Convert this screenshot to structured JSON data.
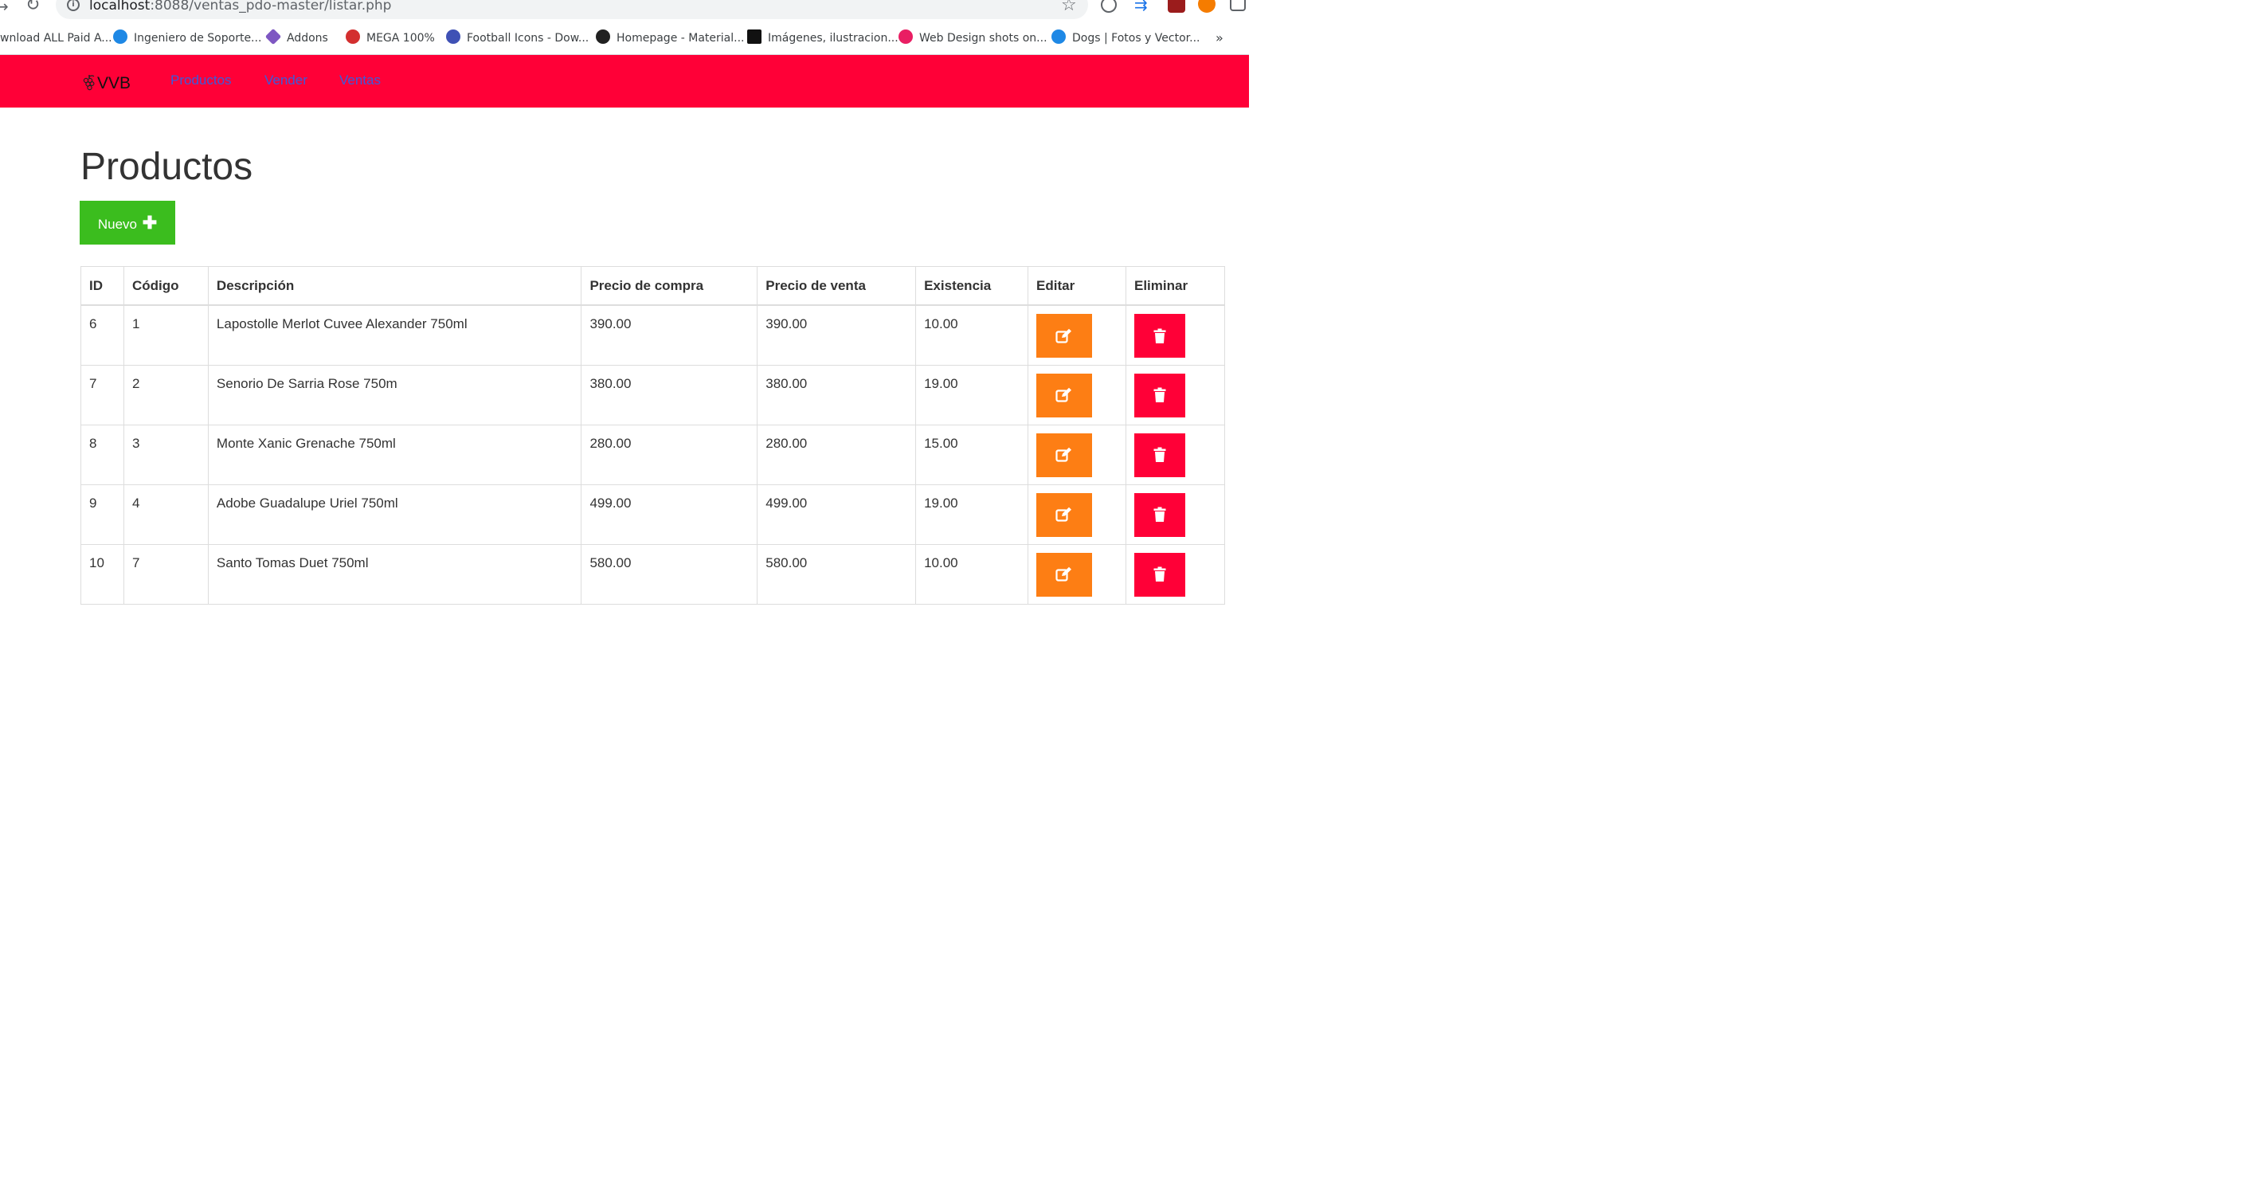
{
  "browser": {
    "url_host": "localhost",
    "url_rest": ":8088/ventas_pdo-master/listar.php",
    "bookmarks": [
      {
        "label": "wnload ALL Paid A...",
        "color": "#ffffff"
      },
      {
        "label": "Ingeniero de Soporte...",
        "color": "#1e88e5"
      },
      {
        "label": "Addons",
        "color": "#7e57c2"
      },
      {
        "label": "MEGA 100%",
        "color": "#d32f2f"
      },
      {
        "label": "Football Icons - Dow...",
        "color": "#3f51b5"
      },
      {
        "label": "Homepage - Material...",
        "color": "#212121"
      },
      {
        "label": "Imágenes, ilustracion...",
        "color": "#111111"
      },
      {
        "label": "Web Design shots on...",
        "color": "#e91e63"
      },
      {
        "label": "Dogs | Fotos y Vector...",
        "color": "#1e88e5"
      }
    ],
    "more": "»"
  },
  "navbar": {
    "brand": "VVB",
    "links": [
      "Productos",
      "Vender",
      "Ventas"
    ],
    "bg_color": "#ff0037"
  },
  "page": {
    "title": "Productos",
    "new_button": "Nuevo",
    "new_icon": "plus-icon"
  },
  "table": {
    "headers": [
      "ID",
      "Código",
      "Descripción",
      "Precio de compra",
      "Precio de venta",
      "Existencia",
      "Editar",
      "Eliminar"
    ],
    "rows": [
      {
        "id": "6",
        "codigo": "1",
        "descripcion": "Lapostolle Merlot Cuvee Alexander 750ml",
        "compra": "390.00",
        "venta": "390.00",
        "existencia": "10.00"
      },
      {
        "id": "7",
        "codigo": "2",
        "descripcion": "Senorio De Sarria Rose 750m",
        "compra": "380.00",
        "venta": "380.00",
        "existencia": "19.00"
      },
      {
        "id": "8",
        "codigo": "3",
        "descripcion": "Monte Xanic Grenache 750ml",
        "compra": "280.00",
        "venta": "280.00",
        "existencia": "15.00"
      },
      {
        "id": "9",
        "codigo": "4",
        "descripcion": "Adobe Guadalupe Uriel 750ml",
        "compra": "499.00",
        "venta": "499.00",
        "existencia": "19.00"
      },
      {
        "id": "10",
        "codigo": "7",
        "descripcion": "Santo Tomas Duet 750ml",
        "compra": "580.00",
        "venta": "580.00",
        "existencia": "10.00"
      }
    ],
    "edit_icon": "edit-icon",
    "delete_icon": "trash-icon"
  }
}
